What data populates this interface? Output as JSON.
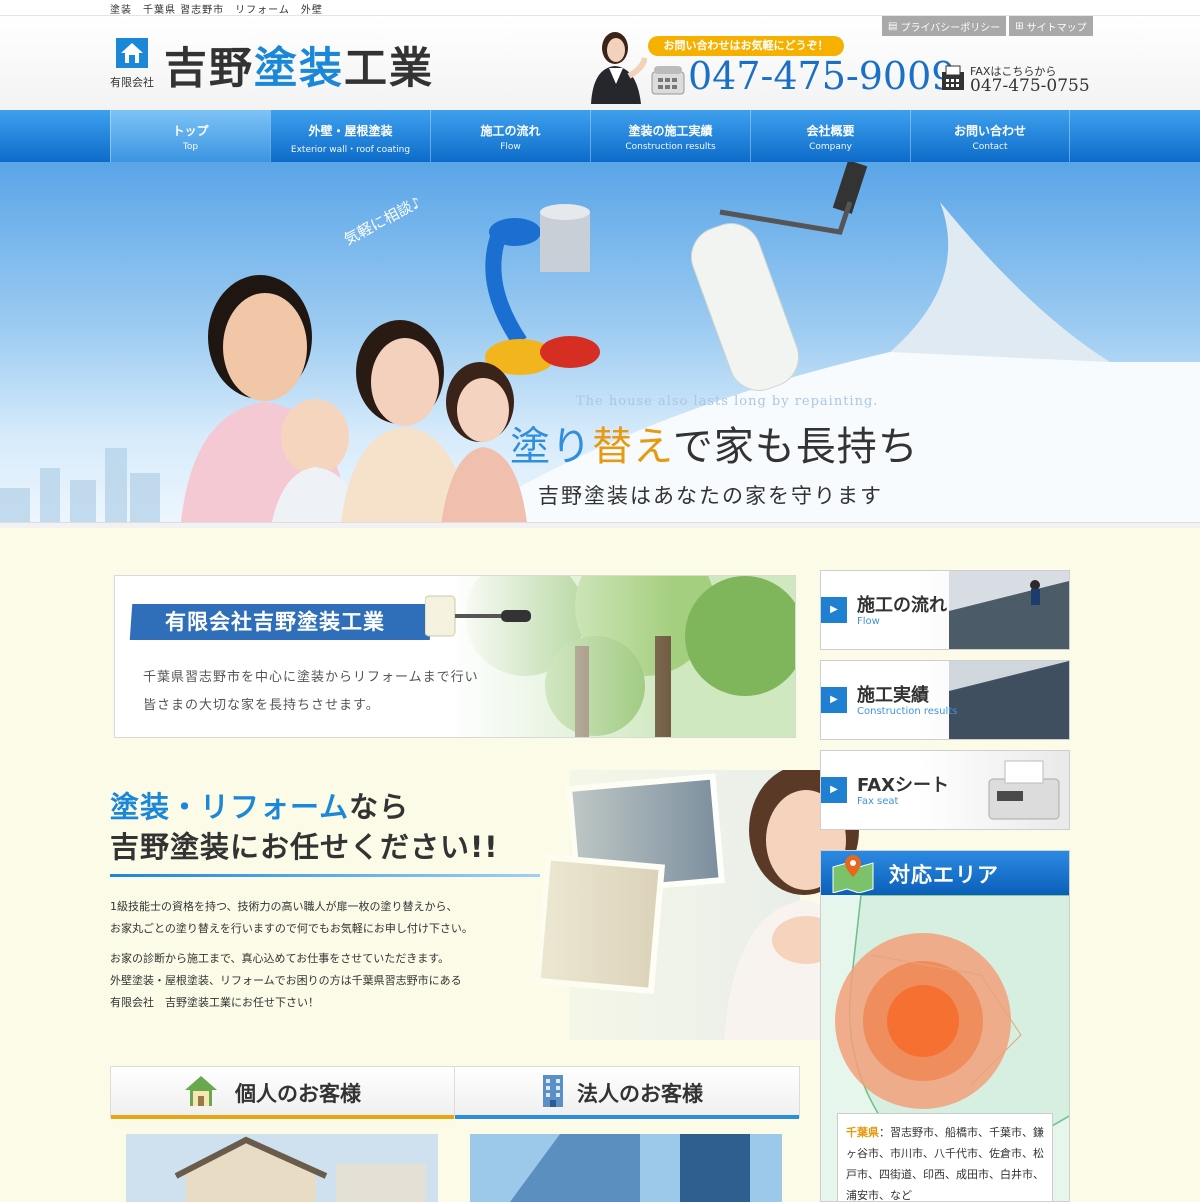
{
  "topbar": {
    "keywords": "塗装　千葉県 習志野市　リフォーム　外壁"
  },
  "header": {
    "logo_small": "有限会社",
    "logo_name_a": "吉野",
    "logo_name_b": "塗装",
    "logo_name_c": "工業",
    "privacy_label": "プライバシーポリシー",
    "sitemap_label": "サイトマップ",
    "contact_bubble": "お問い合わせはお気軽にどうぞ！",
    "tel": "047-475-9009",
    "fax_label": "FAXはこちらから",
    "fax": "047-475-0755"
  },
  "nav": [
    {
      "jp": "トップ",
      "en": "Top"
    },
    {
      "jp": "外壁・屋根塗装",
      "en": "Exterior wall・roof coating"
    },
    {
      "jp": "施工の流れ",
      "en": "Flow"
    },
    {
      "jp": "塗装の施工実績",
      "en": "Construction results"
    },
    {
      "jp": "会社概要",
      "en": "Company"
    },
    {
      "jp": "お問い合わせ",
      "en": "Contact"
    }
  ],
  "hero": {
    "handnote": "気軽に相談♪",
    "tagline_en": "The house also lasts long by repainting.",
    "headline_a": "塗り",
    "headline_b": "替え",
    "headline_c": "で家も長持ち",
    "sub": "吉野塗装はあなたの家を守ります"
  },
  "intro": {
    "banner": "有限会社吉野塗装工業",
    "line1": "千葉県習志野市を中心に塗装からリフォームまで行い",
    "line2": "皆さまの大切な家を長持ちさせます。"
  },
  "pitch": {
    "h1_blue": "塗装・リフォーム",
    "h1_rest": "なら",
    "h2": "吉野塗装にお任せください!!",
    "t1": "1級技能士の資格を持つ、技術力の高い職人が扉一枚の塗り替えから、",
    "t2": "お家丸ごとの塗り替えを行いますので何でもお気軽にお申し付け下さい。",
    "t3": "お家の診断から施工まで、真心込めてお仕事をさせていただきます。",
    "t4": "外壁塗装・屋根塗装、リフォームでお困りの方は千葉県習志野市にある",
    "t5": "有限会社　吉野塗装工業にお任せ下さい！"
  },
  "customers": {
    "personal": "個人のお客様",
    "corporate": "法人のお客様"
  },
  "sidebar": {
    "flow_jp": "施工の流れ",
    "flow_en": "Flow",
    "results_jp": "施工実績",
    "results_en": "Construction results",
    "fax_jp": "FAXシート",
    "fax_en": "Fax seat",
    "area_title": "対応エリア",
    "area_pref": "千葉県",
    "area_cities": "：習志野市、船橋市、千葉市、鎌ヶ谷市、市川市、八千代市、佐倉市、松戸市、四街道、印西、成田市、白井市、浦安市、など"
  },
  "colors": {
    "brand_blue": "#1a87d8",
    "nav_blue": "#0d6cc9",
    "accent_orange": "#e8a512",
    "page_bg": "#fbfbe8"
  }
}
